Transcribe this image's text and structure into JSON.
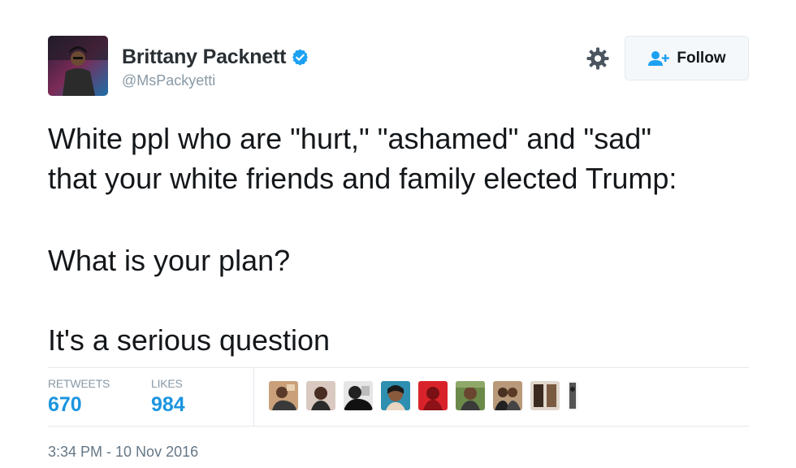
{
  "author": {
    "display_name": "Brittany Packnett",
    "handle": "@MsPackyetti",
    "verified": true
  },
  "actions": {
    "follow_label": "Follow"
  },
  "tweet": {
    "lines": [
      "White ppl who are \"hurt,\" \"ashamed\" and \"sad\"",
      "that your white friends and family elected Trump:",
      "What is your plan?",
      "It's a serious question"
    ]
  },
  "stats": {
    "retweets_label": "RETWEETS",
    "retweets_value": "670",
    "likes_label": "LIKES",
    "likes_value": "984"
  },
  "timestamp": "3:34 PM - 10 Nov 2016",
  "colors": {
    "link_blue": "#1b95e0",
    "verified_blue": "#1da1f2",
    "muted": "#8899a6",
    "border": "#e1e8ed"
  },
  "icons": [
    "verified-badge-icon",
    "gear-icon",
    "follow-person-plus-icon"
  ]
}
